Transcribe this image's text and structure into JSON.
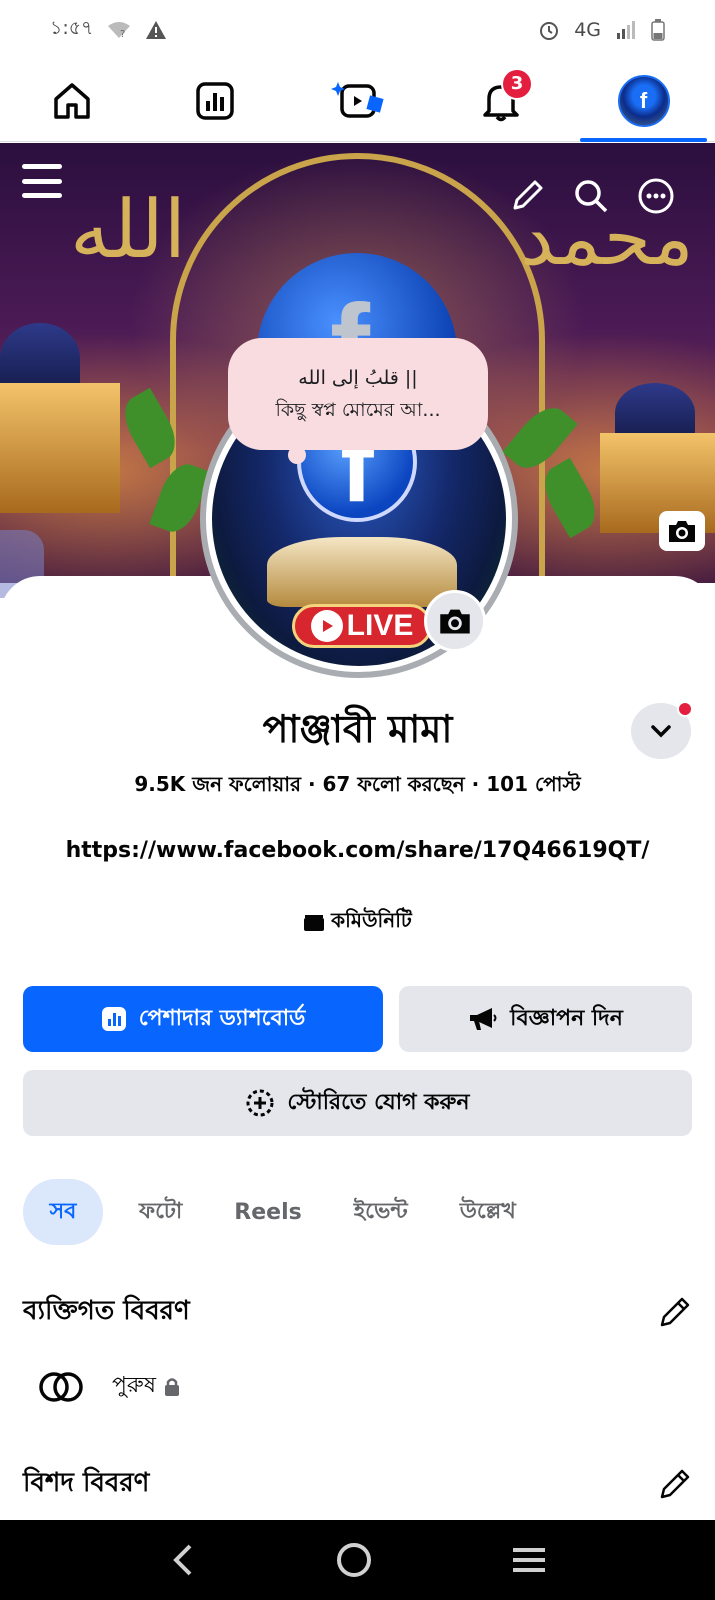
{
  "status_bar": {
    "time": "১:৫৭",
    "network": "4G"
  },
  "top_nav": {
    "notification_count": "3",
    "avatar_letter": "f"
  },
  "cover": {
    "calligraphy_left": "الله",
    "calligraphy_right": "محمد"
  },
  "note": {
    "line1": "قلبُ إلى الله ||",
    "line2": "কিছু স্বপ্ন মোমের আ..."
  },
  "profile": {
    "live_label": "LIVE",
    "fb_letter": "f",
    "name": "পাঞ্জাবী মামা",
    "stats": "9.5K জন ফলোয়ার · 67 ফলো করছেন · 101 পোস্ট",
    "link": "https://www.facebook.com/share/17Q46619QT/",
    "category": "কমিউনিটি"
  },
  "buttons": {
    "dashboard": "পেশাদার ড্যাশবোর্ড",
    "ads": "বিজ্ঞাপন দিন",
    "story": "স্টোরিতে যোগ করুন"
  },
  "tabs": [
    {
      "label": "সব",
      "active": true
    },
    {
      "label": "ফটো",
      "active": false
    },
    {
      "label": "Reels",
      "active": false
    },
    {
      "label": "ইভেন্ট",
      "active": false
    },
    {
      "label": "উল্লেখ",
      "active": false
    }
  ],
  "sections": {
    "personal_details_title": "ব্যক্তিগত বিবরণ",
    "gender": "পুরুষ",
    "detailed_info_title": "বিশদ বিবরণ"
  },
  "colors": {
    "primary": "#0866ff",
    "badge": "#e41e3f",
    "button_gray": "#e4e6eb",
    "active_tab_bg": "#dbe7fb"
  }
}
